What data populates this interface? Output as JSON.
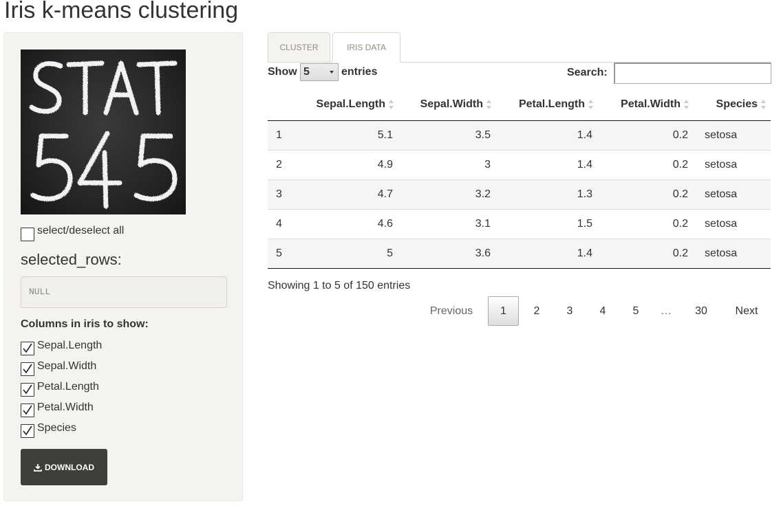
{
  "app": {
    "title": "Iris k-means clustering"
  },
  "sidebar": {
    "logo_text": "STAT 545",
    "select_all_label": "select/deselect all",
    "selected_rows_label": "selected_rows:",
    "selected_rows_value": "NULL",
    "columns_label": "Columns in iris to show:",
    "columns": [
      {
        "label": "Sepal.Length",
        "checked": true
      },
      {
        "label": "Sepal.Width",
        "checked": true
      },
      {
        "label": "Petal.Length",
        "checked": true
      },
      {
        "label": "Petal.Width",
        "checked": true
      },
      {
        "label": "Species",
        "checked": true
      }
    ],
    "download_label": "Download",
    "download_icon": "download-icon"
  },
  "tabs": [
    {
      "label": "Cluster",
      "active": false
    },
    {
      "label": "Iris Data",
      "active": true
    }
  ],
  "table_controls": {
    "show_label": "Show",
    "entries_label": "entries",
    "page_length": "5",
    "search_label": "Search:",
    "search_value": ""
  },
  "table": {
    "columns": [
      "",
      "Sepal.Length",
      "Sepal.Width",
      "Petal.Length",
      "Petal.Width",
      "Species"
    ],
    "rows": [
      [
        "1",
        "5.1",
        "3.5",
        "1.4",
        "0.2",
        "setosa"
      ],
      [
        "2",
        "4.9",
        "3",
        "1.4",
        "0.2",
        "setosa"
      ],
      [
        "3",
        "4.7",
        "3.2",
        "1.3",
        "0.2",
        "setosa"
      ],
      [
        "4",
        "4.6",
        "3.1",
        "1.5",
        "0.2",
        "setosa"
      ],
      [
        "5",
        "5",
        "3.6",
        "1.4",
        "0.2",
        "setosa"
      ]
    ]
  },
  "info": "Showing 1 to 5 of 150 entries",
  "pagination": {
    "previous": "Previous",
    "pages": [
      "1",
      "2",
      "3",
      "4",
      "5"
    ],
    "ellipsis": "…",
    "last": "30",
    "next": "Next",
    "current": "1"
  },
  "colors": {
    "sidebar_bg": "#f5f3ef",
    "button_bg": "#3e3f3a",
    "tab_text": "#8e8c84"
  }
}
